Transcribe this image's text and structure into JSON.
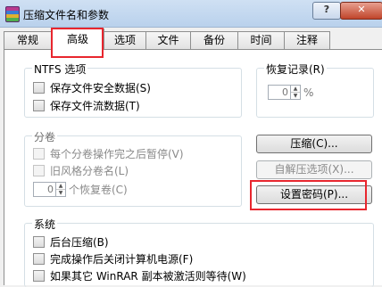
{
  "window": {
    "title": "压缩文件名和参数",
    "help_label": "?",
    "close_label": "✕"
  },
  "tabs": [
    {
      "label": "常规"
    },
    {
      "label": "高级"
    },
    {
      "label": "选项"
    },
    {
      "label": "文件"
    },
    {
      "label": "备份"
    },
    {
      "label": "时间"
    },
    {
      "label": "注释"
    }
  ],
  "ntfs": {
    "legend": "NTFS 选项",
    "options": [
      {
        "label": "保存文件安全数据(S)",
        "checked": false
      },
      {
        "label": "保存文件流数据(T)",
        "checked": false
      }
    ]
  },
  "recovery": {
    "legend": "恢复记录(R)",
    "value": "0",
    "unit": "%"
  },
  "volumes": {
    "legend": "分卷",
    "options": [
      {
        "label": "每个分卷操作完之后暂停(V)",
        "checked": false
      },
      {
        "label": "旧风格分卷名(L)",
        "checked": false
      }
    ],
    "recovery_value": "0",
    "recovery_label": "个恢复卷(C)"
  },
  "buttons": {
    "compress": "压缩(C)...",
    "sfx_options": "自解压选项(X)...",
    "set_password": "设置密码(P)..."
  },
  "system": {
    "legend": "系统",
    "options": [
      {
        "label": "后台压缩(B)",
        "checked": false
      },
      {
        "label": "完成操作后关闭计算机电源(F)",
        "checked": false
      },
      {
        "label": "如果其它 WinRAR 副本被激活则等待(W)",
        "checked": false
      }
    ]
  },
  "highlight_color": "#e8262e"
}
